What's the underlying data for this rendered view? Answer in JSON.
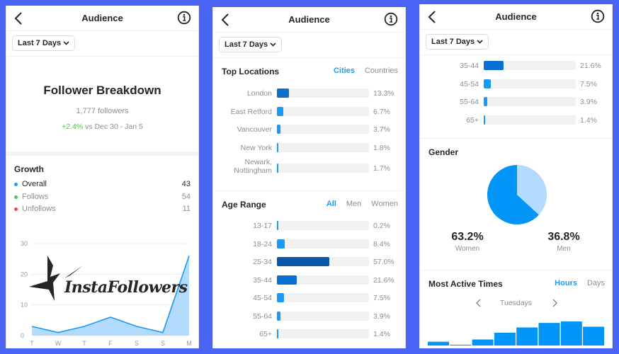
{
  "colors": {
    "background": "#4a64f6",
    "accent": "#1d9bf0",
    "positive": "#4cc552",
    "bar_dark": "#0a56a8",
    "bar_mid": "#0a6fd0",
    "bar_light": "#1a98f5",
    "pie_women": "#0095f6",
    "pie_men": "#b3dbfd",
    "area_fill": "#b3dbfd",
    "line": "#1a98f5"
  },
  "header": {
    "title": "Audience",
    "back_icon": "chevron-left-icon",
    "info_icon": "info-circle-icon",
    "filter_label": "Last 7 Days"
  },
  "panel1": {
    "breakdown_title": "Follower Breakdown",
    "followers": "1,777 followers",
    "change_value": "+2.4%",
    "change_suffix": " vs Dec 30 - Jan 5",
    "growth_title": "Growth",
    "growth_items": [
      {
        "label": "Overall",
        "value": "43",
        "color": "#1d9bf0"
      },
      {
        "label": "Follows",
        "value": "54",
        "color": "#4cc552"
      },
      {
        "label": "Unfollows",
        "value": "11",
        "color": "#ed4956"
      }
    ],
    "watermark": "InstaFollowers"
  },
  "chart_data": [
    {
      "type": "area",
      "title": "Growth",
      "x": [
        "T",
        "W",
        "T",
        "F",
        "S",
        "S",
        "M"
      ],
      "values": [
        3,
        1,
        3,
        6,
        3,
        1,
        26
      ],
      "yticks": [
        0,
        10,
        20,
        30
      ],
      "ylim": [
        0,
        30
      ],
      "grid": true
    },
    {
      "type": "bar",
      "orientation": "horizontal",
      "title": "Top Locations",
      "categories": [
        "London",
        "East Retford",
        "Vancouver",
        "New York",
        "Newark, Nottingham"
      ],
      "values": [
        13.3,
        6.7,
        3.7,
        1.8,
        1.7
      ],
      "unit": "%"
    },
    {
      "type": "bar",
      "orientation": "horizontal",
      "title": "Age Range",
      "categories": [
        "13-17",
        "18-24",
        "25-34",
        "35-44",
        "45-54",
        "55-64",
        "65+"
      ],
      "values": [
        0.2,
        8.4,
        57.0,
        21.6,
        7.5,
        3.9,
        1.4
      ],
      "unit": "%"
    },
    {
      "type": "pie",
      "title": "Gender",
      "categories": [
        "Women",
        "Men"
      ],
      "values": [
        63.2,
        36.8
      ],
      "unit": "%"
    },
    {
      "type": "bar",
      "title": "Most Active Times",
      "subtitle": "Tuesdays",
      "values_relative": [
        5,
        1,
        8,
        17,
        24,
        30,
        32,
        25
      ]
    }
  ],
  "panel2": {
    "locations_title": "Top Locations",
    "location_tabs": [
      "Cities",
      "Countries"
    ],
    "locations": [
      {
        "label": "London",
        "value": "13.3%",
        "pct": 13.3
      },
      {
        "label": "East Retford",
        "value": "6.7%",
        "pct": 6.7
      },
      {
        "label": "Vancouver",
        "value": "3.7%",
        "pct": 3.7
      },
      {
        "label": "New York",
        "value": "1.8%",
        "pct": 1.8
      },
      {
        "label": "Newark, Nottingham",
        "value": "1.7%",
        "pct": 1.7
      }
    ],
    "age_title": "Age Range",
    "age_tabs": [
      "All",
      "Men",
      "Women"
    ],
    "ages": [
      {
        "label": "13-17",
        "value": "0.2%",
        "pct": 0.2
      },
      {
        "label": "18-24",
        "value": "8.4%",
        "pct": 8.4
      },
      {
        "label": "25-34",
        "value": "57.0%",
        "pct": 57.0
      },
      {
        "label": "35-44",
        "value": "21.6%",
        "pct": 21.6
      },
      {
        "label": "45-54",
        "value": "7.5%",
        "pct": 7.5
      },
      {
        "label": "55-64",
        "value": "3.9%",
        "pct": 3.9
      },
      {
        "label": "65+",
        "value": "1.4%",
        "pct": 1.4
      }
    ]
  },
  "panel3": {
    "ages": [
      {
        "label": "35-44",
        "value": "21.6%",
        "pct": 21.6
      },
      {
        "label": "45-54",
        "value": "7.5%",
        "pct": 7.5
      },
      {
        "label": "55-64",
        "value": "3.9%",
        "pct": 3.9
      },
      {
        "label": "65+",
        "value": "1.4%",
        "pct": 1.4
      }
    ],
    "gender_title": "Gender",
    "women_pct": "63.2%",
    "women_label": "Women",
    "men_pct": "36.8%",
    "men_label": "Men",
    "active_title": "Most Active Times",
    "active_tabs": [
      "Hours",
      "Days"
    ],
    "day_label": "Tuesdays"
  }
}
